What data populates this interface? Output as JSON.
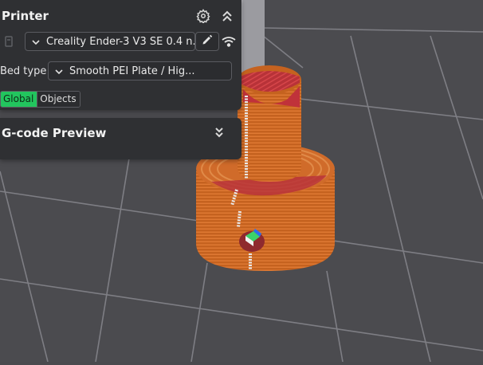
{
  "printer_panel": {
    "title": "Printer",
    "printer_name": "Creality Ender-3 V3 SE 0.4 n...",
    "bed_type_label": "Bed type",
    "bed_type_value": "Smooth PEI Plate / Hig...",
    "toggle_global": "Global",
    "toggle_objects": "Objects"
  },
  "gcode_panel": {
    "title": "G-code Preview"
  },
  "colors": {
    "accent_green": "#22c55e",
    "panel_bg": "#2f3033",
    "model_orange": "#c9601f",
    "model_red": "#c0323a"
  },
  "icons": [
    "gear-icon",
    "collapse-up-icon",
    "printer-icon",
    "chevron-down-icon",
    "edit-icon",
    "wifi-icon",
    "expand-down-icon"
  ]
}
